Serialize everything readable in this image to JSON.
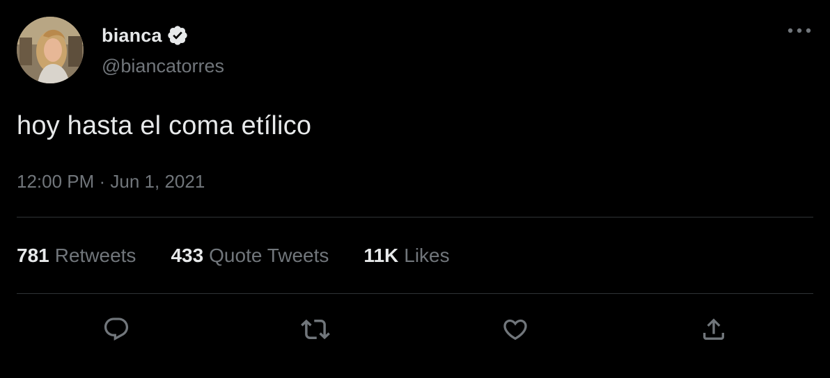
{
  "author": {
    "display_name": "bianca",
    "handle": "@biancatorres",
    "verified": true,
    "avatar_icon": "profile-photo"
  },
  "tweet": {
    "text": "hoy hasta el coma etílico",
    "timestamp": "12:00 PM · Jun 1, 2021"
  },
  "stats": {
    "retweets_count": "781",
    "retweets_label": "Retweets",
    "quotes_count": "433",
    "quotes_label": "Quote Tweets",
    "likes_count": "11K",
    "likes_label": "Likes"
  },
  "actions": {
    "reply_icon": "reply-icon",
    "retweet_icon": "retweet-icon",
    "like_icon": "heart-icon",
    "share_icon": "share-icon"
  },
  "colors": {
    "background": "#000000",
    "primary_text": "#e7e9ea",
    "secondary_text": "#71767b",
    "divider": "#2f3336"
  }
}
